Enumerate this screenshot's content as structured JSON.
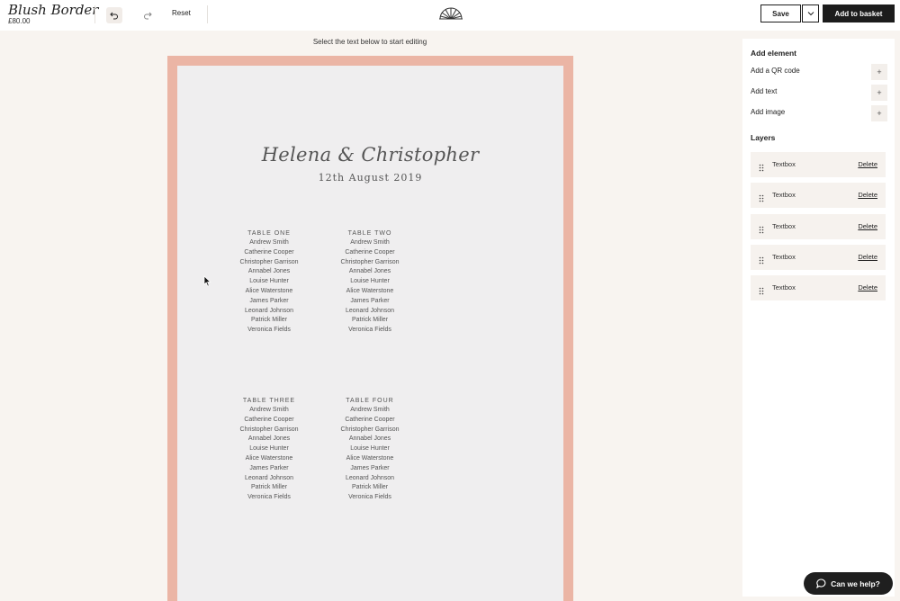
{
  "header": {
    "product_title": "Blush Border",
    "price": "£80.00",
    "reset_label": "Reset",
    "save_label": "Save",
    "basket_label": "Add to basket"
  },
  "editor": {
    "hint": "Select the text below to start editing"
  },
  "card": {
    "names": "Helena & Christopher",
    "date": "12th August 2019",
    "tables": [
      {
        "name": "TABLE ONE",
        "guests": [
          "Andrew Smith",
          "Catherine Cooper",
          "Christopher Garrison",
          "Annabel Jones",
          "Louise Hunter",
          "Alice Waterstone",
          "James Parker",
          "Leonard Johnson",
          "Patrick Miller",
          "Veronica Fields"
        ]
      },
      {
        "name": "TABLE TWO",
        "guests": [
          "Andrew Smith",
          "Catherine Cooper",
          "Christopher Garrison",
          "Annabel Jones",
          "Louise Hunter",
          "Alice Waterstone",
          "James Parker",
          "Leonard Johnson",
          "Patrick Miller",
          "Veronica Fields"
        ]
      },
      {
        "name": "TABLE THREE",
        "guests": [
          "Andrew Smith",
          "Catherine Cooper",
          "Christopher Garrison",
          "Annabel Jones",
          "Louise Hunter",
          "Alice Waterstone",
          "James Parker",
          "Leonard Johnson",
          "Patrick Miller",
          "Veronica Fields"
        ]
      },
      {
        "name": "TABLE FOUR",
        "guests": [
          "Andrew Smith",
          "Catherine Cooper",
          "Christopher Garrison",
          "Annabel Jones",
          "Louise Hunter",
          "Alice Waterstone",
          "James Parker",
          "Leonard Johnson",
          "Patrick Miller",
          "Veronica Fields"
        ]
      }
    ]
  },
  "panel": {
    "add_heading": "Add element",
    "add_items": [
      {
        "label": "Add a QR code",
        "icon": "plus-icon"
      },
      {
        "label": "Add text",
        "icon": "plus-icon"
      },
      {
        "label": "Add image",
        "icon": "plus-icon"
      }
    ],
    "plus_symbol": "+",
    "layers_heading": "Layers",
    "layers": [
      {
        "label": "Textbox",
        "delete": "Delete"
      },
      {
        "label": "Textbox",
        "delete": "Delete"
      },
      {
        "label": "Textbox",
        "delete": "Delete"
      },
      {
        "label": "Textbox",
        "delete": "Delete"
      },
      {
        "label": "Textbox",
        "delete": "Delete"
      }
    ]
  },
  "help": {
    "label": "Can we help?"
  },
  "colors": {
    "border": "#ebb5a5",
    "paper": "#efeeef",
    "background": "#f8f4f0",
    "primary_button": "#1c1c1c"
  }
}
